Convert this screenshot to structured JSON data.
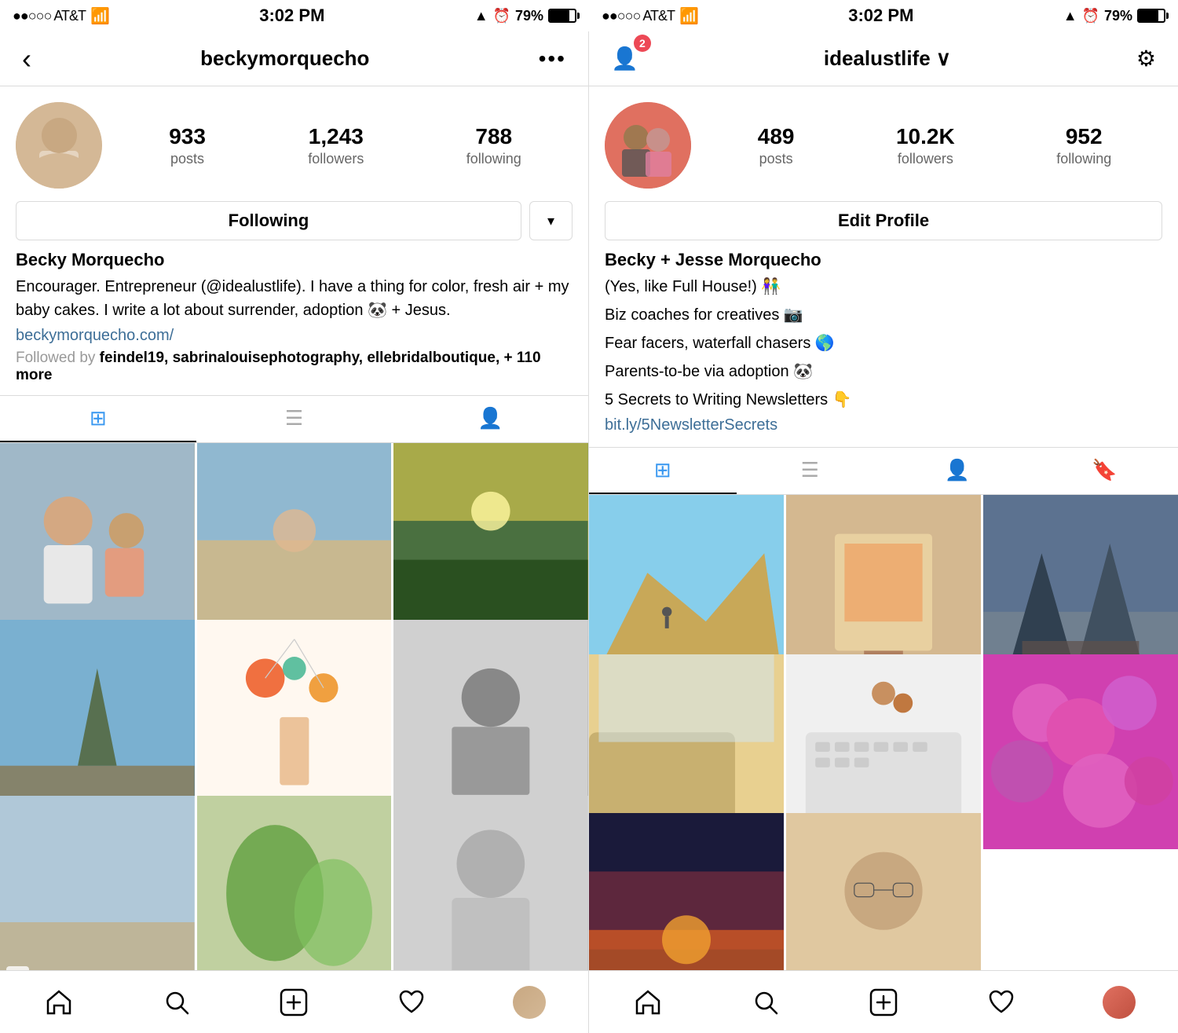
{
  "screens": {
    "left": {
      "status": {
        "carrier": "●●○○○ AT&T",
        "time": "3:02 PM",
        "battery": "79%"
      },
      "nav": {
        "back_icon": "‹",
        "title": "beckymorquecho",
        "more_icon": "•••"
      },
      "profile": {
        "stats": [
          {
            "value": "933",
            "label": "posts"
          },
          {
            "value": "1,243",
            "label": "followers"
          },
          {
            "value": "788",
            "label": "following"
          }
        ],
        "follow_button": "Following",
        "dropdown_icon": "▾",
        "name": "Becky Morquecho",
        "bio": "Encourager. Entrepreneur (@idealustlife). I have a thing for color, fresh air + my baby cakes. I write a lot about surrender, adoption 🐼 + Jesus.",
        "website": "beckymorquecho.com/",
        "followed_by_label": "Followed by ",
        "followed_by": "feindel19, sabrinalouisephotography, ellebridalboutique",
        "followed_by_more": "+ 110 more"
      },
      "tabs": [
        {
          "icon": "⊞",
          "active": true
        },
        {
          "icon": "≡",
          "active": false
        },
        {
          "icon": "👤",
          "active": false
        }
      ],
      "grid": [
        {
          "color": "photo-1"
        },
        {
          "color": "photo-2"
        },
        {
          "color": "photo-3"
        },
        {
          "color": "photo-4"
        },
        {
          "color": "photo-5"
        },
        {
          "color": "photo-6"
        },
        {
          "color": "photo-7"
        },
        {
          "color": "photo-8"
        },
        {
          "color": "photo-9"
        }
      ],
      "bottom_nav": [
        {
          "icon": "⌂",
          "name": "home"
        },
        {
          "icon": "🔍",
          "name": "search"
        },
        {
          "icon": "⊕",
          "name": "add"
        },
        {
          "icon": "♡",
          "name": "heart"
        },
        {
          "icon": "avatar",
          "name": "profile"
        }
      ]
    },
    "right": {
      "status": {
        "carrier": "●●○○○ AT&T",
        "time": "3:02 PM",
        "battery": "79%"
      },
      "nav": {
        "add_friend_icon": "👤+",
        "badge_count": "2",
        "title": "idealustlife ∨",
        "settings_icon": "⚙"
      },
      "profile": {
        "stats": [
          {
            "value": "489",
            "label": "posts"
          },
          {
            "value": "10.2K",
            "label": "followers"
          },
          {
            "value": "952",
            "label": "following"
          }
        ],
        "edit_button": "Edit Profile",
        "name": "Becky + Jesse Morquecho",
        "bio_lines": [
          "(Yes, like Full House!) 👫",
          "Biz coaches for creatives 📷",
          "Fear facers, waterfall chasers 🌎",
          "Parents-to-be via adoption 🐼",
          "5 Secrets to Writing Newsletters 👇"
        ],
        "website": "bit.ly/5NewsletterSecrets"
      },
      "tabs": [
        {
          "icon": "⊞",
          "active": true
        },
        {
          "icon": "≡",
          "active": false
        },
        {
          "icon": "👤",
          "active": false
        },
        {
          "icon": "🔖",
          "active": false
        }
      ],
      "grid": [
        {
          "color": "photo-r1"
        },
        {
          "color": "photo-r2"
        },
        {
          "color": "photo-r3"
        },
        {
          "color": "photo-r4"
        },
        {
          "color": "photo-r5"
        },
        {
          "color": "photo-r6"
        },
        {
          "color": "photo-r7"
        },
        {
          "color": "photo-r8"
        }
      ],
      "bottom_nav": [
        {
          "icon": "⌂",
          "name": "home"
        },
        {
          "icon": "🔍",
          "name": "search"
        },
        {
          "icon": "⊕",
          "name": "add"
        },
        {
          "icon": "♡",
          "name": "heart"
        },
        {
          "icon": "avatar",
          "name": "profile"
        }
      ]
    }
  }
}
